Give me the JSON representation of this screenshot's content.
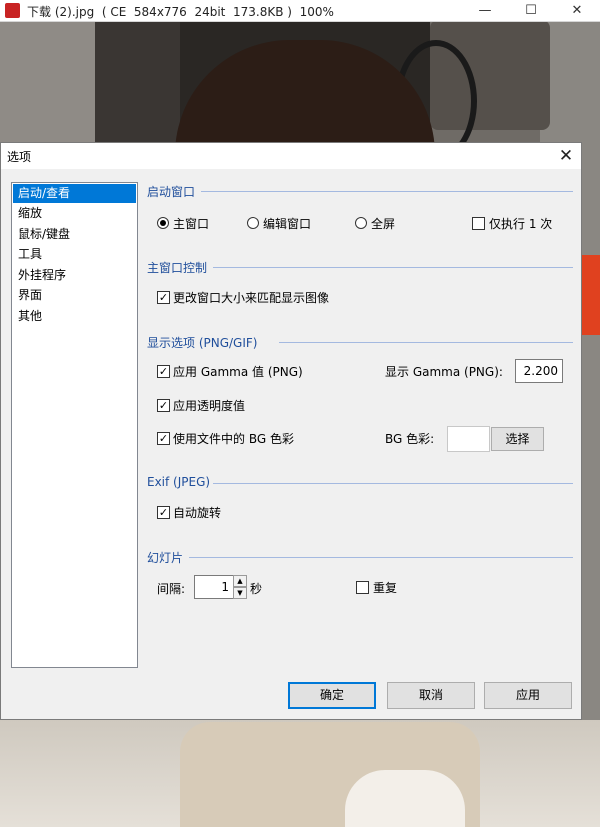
{
  "viewer": {
    "title": "下载 (2).jpg  ( CE  584x776  24bit  173.8KB )  100%",
    "window_buttons": {
      "minimize": "—",
      "maximize": "☐",
      "close": "✕"
    }
  },
  "dialog": {
    "title": "选项",
    "close_glyph": "✕",
    "nav": [
      "启动/查看",
      "缩放",
      "鼠标/键盘",
      "工具",
      "外挂程序",
      "界面",
      "其他"
    ],
    "nav_active_index": 0,
    "sections": {
      "startup_window": {
        "title": "启动窗口",
        "options": [
          {
            "label": "主窗口",
            "selected": true
          },
          {
            "label": "编辑窗口",
            "selected": false
          },
          {
            "label": "全屏",
            "selected": false
          }
        ],
        "only_once": {
          "label": "仅执行 1 次",
          "checked": false
        }
      },
      "main_window_control": {
        "title": "主窗口控制",
        "resize": {
          "label": "更改窗口大小来匹配显示图像",
          "checked": true
        }
      },
      "display_options": {
        "title": "显示选项 (PNG/GIF)",
        "apply_gamma": {
          "label": "应用 Gamma 值 (PNG)",
          "checked": true
        },
        "gamma_label": "显示 Gamma (PNG):",
        "gamma_value": "2.200",
        "apply_transparency": {
          "label": "应用透明度值",
          "checked": true
        },
        "use_bg": {
          "label": "使用文件中的 BG 色彩",
          "checked": true
        },
        "bg_label": "BG 色彩:",
        "bg_color": "#ffffff",
        "choose_button": "选择"
      },
      "exif": {
        "title": "Exif (JPEG)",
        "auto_rotate": {
          "label": "自动旋转",
          "checked": true
        }
      },
      "slideshow": {
        "title": "幻灯片",
        "interval_label": "间隔:",
        "interval_value": "1",
        "seconds_label": "秒",
        "repeat": {
          "label": "重复",
          "checked": false
        }
      }
    },
    "buttons": {
      "ok": "确定",
      "cancel": "取消",
      "apply": "应用"
    }
  },
  "colors": {
    "accent": "#0078d7",
    "section_title": "#1f4e9b",
    "dialog_bg": "#f0f0f0"
  }
}
